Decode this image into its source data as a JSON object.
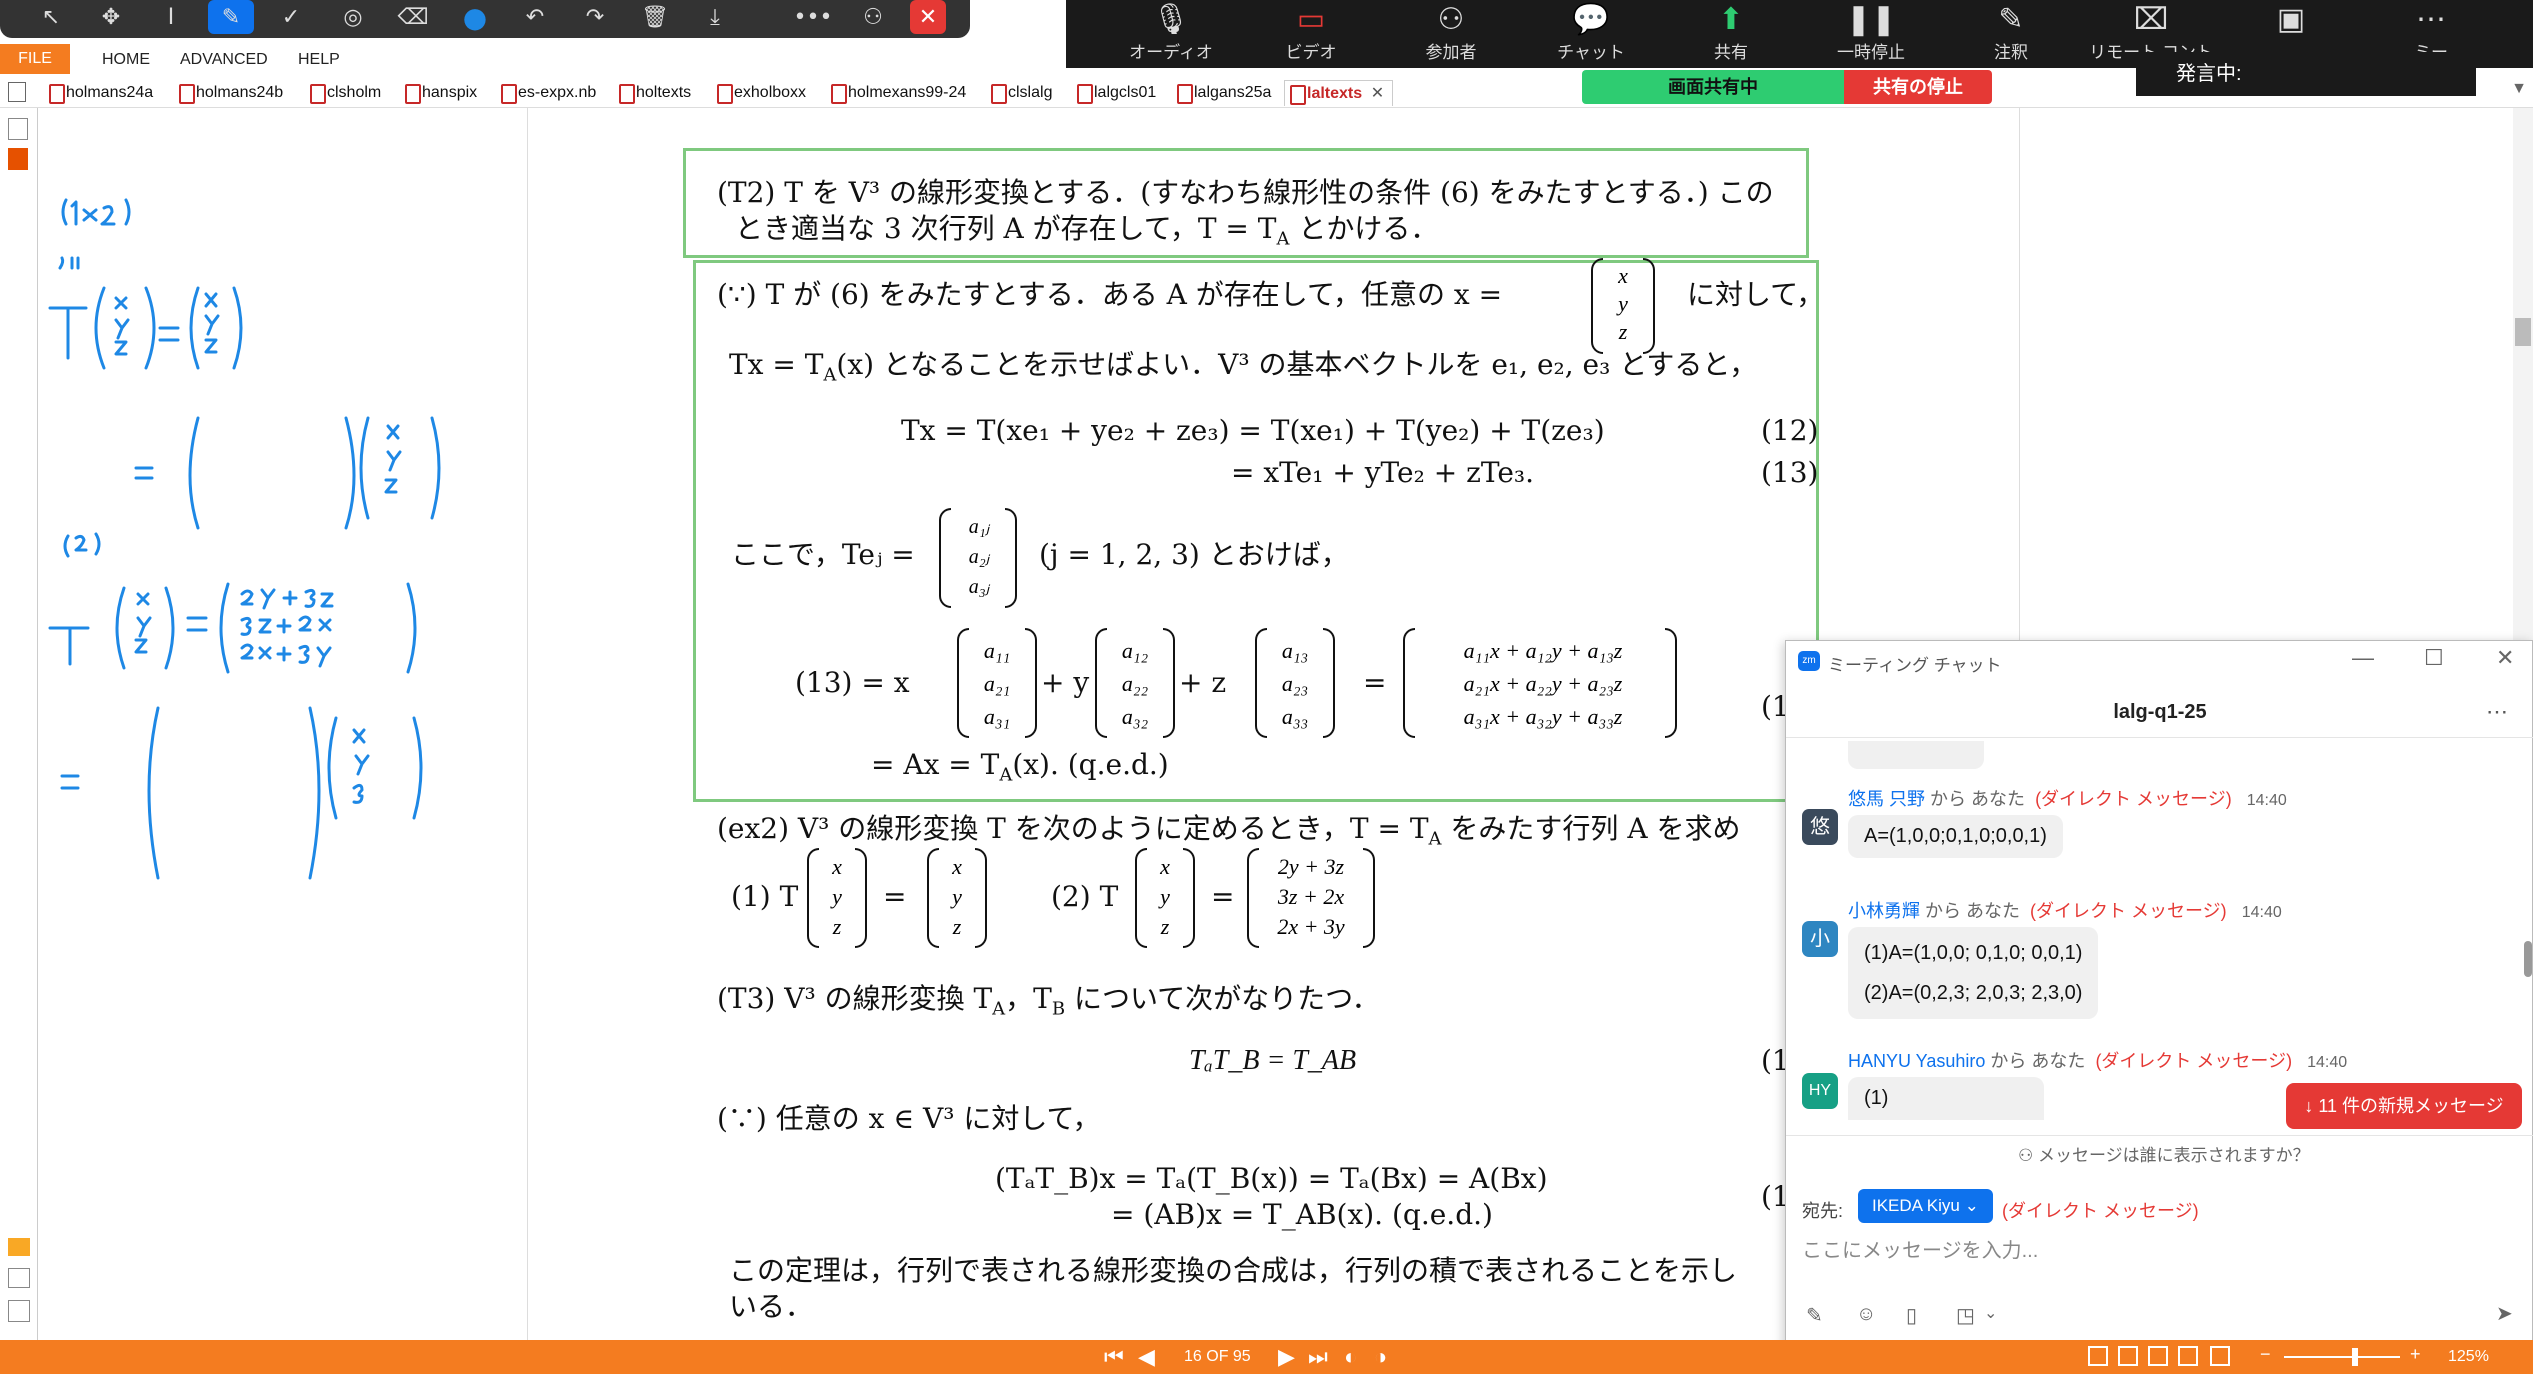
{
  "menu": {
    "file": "FILE",
    "home": "HOME",
    "advanced": "ADVANCED",
    "help": "HELP"
  },
  "tabs": [
    "holmans24a",
    "holmans24b",
    "clsholm",
    "hanspix",
    "es-expx.nb",
    "holtexts",
    "exholboxx",
    "holmexans99-24",
    "clslalg",
    "lalgcls01",
    "lalgans25a",
    "laltexts"
  ],
  "active_tab": "laltexts",
  "zoom": {
    "controls": [
      "オーディオ",
      "ビデオ",
      "参加者",
      "チャット",
      "共有",
      "一時停止",
      "注釈",
      "リモート コント",
      "",
      "ミー"
    ],
    "speaking": "発言中:",
    "sharing": "画面共有中",
    "stop_share": "共有の停止"
  },
  "page": {
    "t2_line1": "(T2) T を V³ の線形変換とする．(すなわち線形性の条件 (6) をみたすとする．)  この",
    "t2_line2": "とき適当な 3 次行列 A が存在して，T = T",
    "t2_line2_sub": "A",
    "t2_line2_end": " とかける．",
    "proof_a": "(∵) T が (6) をみたすとする．ある A が存在して，任意の x =",
    "proof_a_end": "に対して，",
    "proof_b": "Tx = T",
    "proof_b_sub": "A",
    "proof_b_end": "(x) となることを示せばよい．V³ の基本ベクトルを e₁, e₂, e₃ とすると，",
    "eq12": "Tx = T(xe₁ + ye₂ + ze₃) =   T(xe₁) + T(ye₂) + T(ze₃)",
    "eq12_no": "(12)",
    "eq13": "=      xTe₁ + yTe₂ + zTe₃.",
    "eq13_no": "(13)",
    "koko": "ここで，Teⱼ =",
    "koko_end": "(j = 1, 2, 3) とおけば，",
    "big_lhs": "(13)   = x",
    "big_p1": "+ y",
    "big_p2": "+ z",
    "big_eq": "=",
    "big_no": "(1",
    "last_line": "= Ax = T",
    "last_sub": "A",
    "last_end": "(x).        (q.e.d.)",
    "ex2": "(ex2) V³ の線形変換 T を次のように定めるとき，T = T",
    "ex2_sub": "A",
    "ex2_end": " をみたす行列 A を求め",
    "ex2_1": "(1) T",
    "ex2_eq": "=",
    "ex2_2": "(2) T",
    "t3": "(T3) V³ の線形変換 T",
    "t3_a": "A",
    "t3_mid": "，T",
    "t3_b": "B",
    "t3_end": " について次がなりたつ．",
    "t3_eq": "T",
    "t3_eq_full": "TₐT_B = T_AB",
    "t3_no": "(1",
    "proof3": "(∵) 任意の x ∈ V³ に対して，",
    "p3_l1": "(TₐT_B)x   = Tₐ(T_B(x)) = Tₐ(Bx) = A(Bx)",
    "p3_l2": "= (AB)x = T_AB(x).        (q.e.d.)",
    "p3_no": "(1",
    "closing1": "この定理は，行列で表される線形変換の合成は，行列の積で表されることを示し",
    "closing2": "いる．",
    "vec_xyz": [
      "x",
      "y",
      "z"
    ],
    "vec_aj": [
      "a₁ⱼ",
      "a₂ⱼ",
      "a₃ⱼ"
    ],
    "col1": [
      "a₁₁",
      "a₂₁",
      "a₃₁"
    ],
    "col2": [
      "a₁₂",
      "a₂₂",
      "a₃₂"
    ],
    "col3": [
      "a₁₃",
      "a₂₃",
      "a₃₃"
    ],
    "result": [
      "a₁₁x + a₁₂y + a₁₃z",
      "a₂₁x + a₂₂y + a₂₃z",
      "a₃₁x + a₃₂y + a₃₃z"
    ],
    "ex2_rhs2": [
      "2y + 3z",
      "3z + 2x",
      "2x + 3y"
    ]
  },
  "chat": {
    "window_title": "ミーティング チャット",
    "title": "lalg-q1-25",
    "messages": [
      {
        "avatar": "悠",
        "avatar_color": "#3a4a5c",
        "from": "悠馬 只野",
        "to": "から あなた",
        "dm": "(ダイレクト メッセージ)",
        "time": "14:40",
        "lines": [
          "A=(1,0,0;0,1,0;0,0,1)"
        ]
      },
      {
        "avatar": "小",
        "avatar_color": "#2e86c1",
        "from": "小林勇輝",
        "to": "から あなた",
        "dm": "(ダイレクト メッセージ)",
        "time": "14:40",
        "lines": [
          "(1)A=(1,0,0; 0,1,0; 0,0,1)",
          "(2)A=(0,2,3; 2,0,3; 2,3,0)"
        ]
      },
      {
        "avatar": "HY",
        "avatar_color": "#16a085",
        "from": "HANYU Yasuhiro",
        "to": "から あなた",
        "dm": "(ダイレクト メッセージ)",
        "time": "14:40",
        "lines": [
          "(1)"
        ]
      }
    ],
    "new_messages": "↓  11 件の新規メッセージ",
    "who_sees": "メッセージは誰に表示されますか？",
    "to_label": "宛先:",
    "recipient": "IKEDA Kiyu",
    "recipient_dm": "(ダイレクト メッセージ)",
    "input_placeholder": "ここにメッセージを入力..."
  },
  "status": {
    "page": "16 OF 95",
    "zoom": "125%"
  },
  "colors": {
    "accent_orange": "#f47c20",
    "zoom_blue": "#0e72ed",
    "frame_green": "#7fc97f",
    "ink_blue": "#1e88e5",
    "dm_red": "#e53935"
  }
}
